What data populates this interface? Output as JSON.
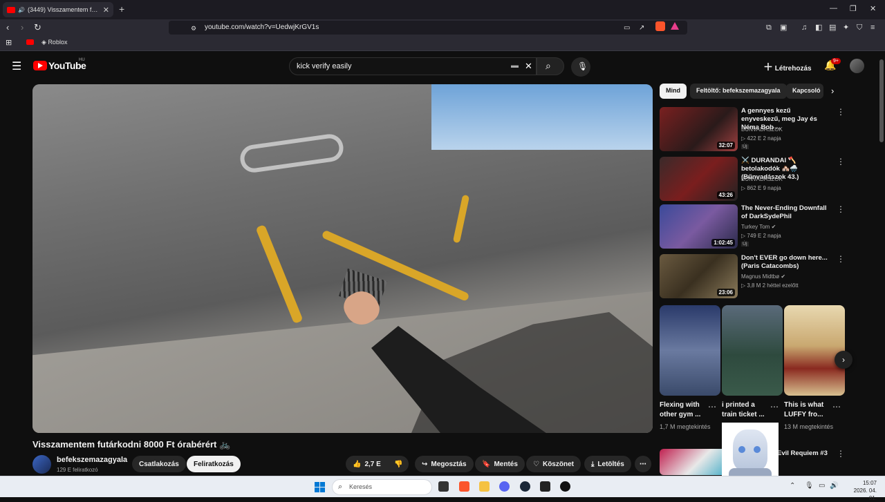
{
  "browser": {
    "tab_title": "(3449) Visszamentem futárkodni 8000 Ft órabérért",
    "url": "youtube.com/watch?v=UedwjKrGV1s",
    "bookmarks": [
      {
        "label": ""
      },
      {
        "label": "Roblox"
      }
    ]
  },
  "youtube": {
    "logo_text": "YouTube",
    "region": "HU",
    "search_query": "kick verify easily",
    "create_label": "Létrehozás",
    "notification_count": "9+"
  },
  "video": {
    "title": "Visszamentem futárkodni 8000 Ft órabérért 🚲",
    "channel": "befekszemazagyala",
    "subscribers": "129 E feliratkozó",
    "join_label": "Csatlakozás",
    "subscribe_label": "Feliratkozás",
    "likes": "2,7 E",
    "share_label": "Megosztás",
    "save_label": "Mentés",
    "thanks_label": "Köszönet",
    "download_label": "Letöltés"
  },
  "sidebar": {
    "chips": [
      "Mind",
      "Feltöltő: befekszemazagyala",
      "Kapcsoló"
    ],
    "recommendations": [
      {
        "title": "A gennyes kezű enyveskezű, meg Jay és Néma Bob ...",
        "channel": "BŰNVADÁSZOK",
        "meta": "▷ 422 E  2 napja",
        "duration": "32:07",
        "badge": "Új",
        "thumb_color": "#6b1a1a"
      },
      {
        "title": "⚔️ DURANDAI 🪓 betolakodók 🏘️🌧️ (Bűnvadászok 43.)",
        "channel": "BŰNVADÁSZOK",
        "meta": "▷ 862 E  9 napja",
        "duration": "43:26",
        "badge": "",
        "thumb_color": "#3a2a2a"
      },
      {
        "title": "The Never-Ending Downfall of DarkSydePhil",
        "channel": "Turkey Tom ✔",
        "meta": "▷ 749 E  2 napja",
        "duration": "1:02:45",
        "badge": "Új",
        "thumb_color": "#4a3a7a"
      },
      {
        "title": "Don't EVER go down here... (Paris Catacombs)",
        "channel": "Magnus Midtbø ✔",
        "meta": "▷ 3,8 M  2 héttel ezelőtt",
        "duration": "23:06",
        "badge": "",
        "thumb_color": "#5a4a30"
      }
    ],
    "shorts": [
      {
        "title": "Flexing with other gym ...",
        "views": "1,7 M megtekintés",
        "thumb_color": "#3b4a6a"
      },
      {
        "title": "i printed a train ticket ...",
        "views": "",
        "thumb_color": "#2e4a3e"
      },
      {
        "title": "This is what LUFFY fro...",
        "views": "13 M megtekintés",
        "thumb_color": "#c9b38a"
      }
    ],
    "partial_item_title": "Evil Requiem #3"
  },
  "taskbar": {
    "search_placeholder": "Keresés",
    "time": "15:07",
    "date": "2026. 04. 01."
  }
}
